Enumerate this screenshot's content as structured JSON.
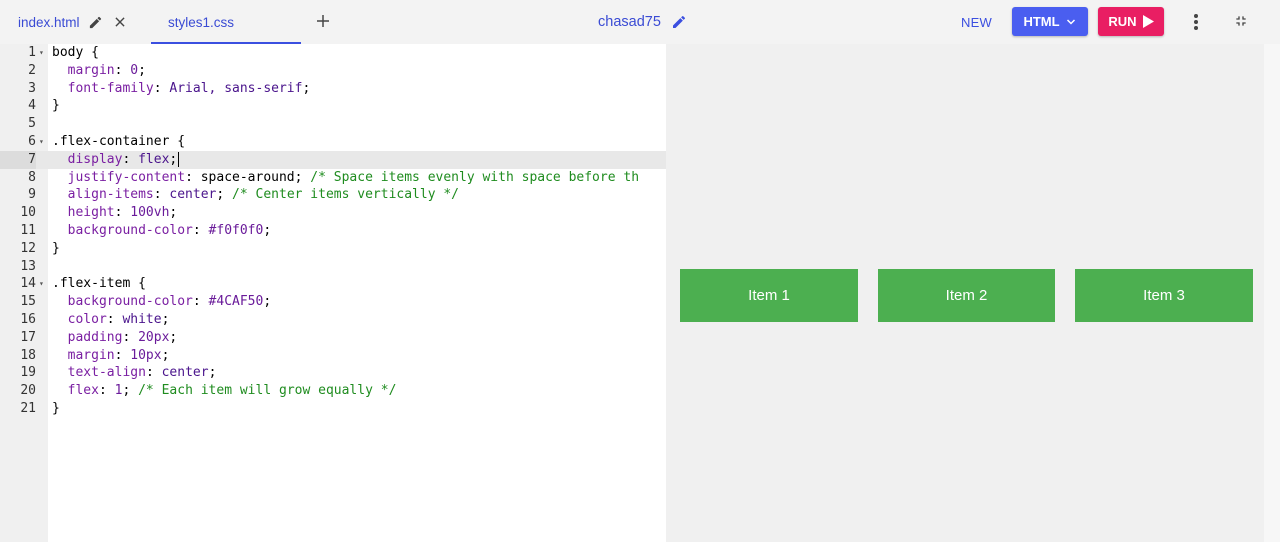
{
  "tabs": [
    {
      "label": "index.html"
    },
    {
      "label": "styles1.css"
    }
  ],
  "project": {
    "name": "chasad75"
  },
  "toolbar": {
    "new_label": "NEW",
    "html_label": "HTML",
    "run_label": "RUN"
  },
  "colors": {
    "accent": "#4a5ef0",
    "run": "#e91e63",
    "item": "#4caf50"
  },
  "editor": {
    "active_line": 7,
    "lines": [
      {
        "n": "1",
        "fold": true
      },
      {
        "n": "2"
      },
      {
        "n": "3"
      },
      {
        "n": "4"
      },
      {
        "n": "5"
      },
      {
        "n": "6",
        "fold": true
      },
      {
        "n": "7"
      },
      {
        "n": "8"
      },
      {
        "n": "9"
      },
      {
        "n": "10"
      },
      {
        "n": "11"
      },
      {
        "n": "12"
      },
      {
        "n": "13"
      },
      {
        "n": "14",
        "fold": true
      },
      {
        "n": "15"
      },
      {
        "n": "16"
      },
      {
        "n": "17"
      },
      {
        "n": "18"
      },
      {
        "n": "19"
      },
      {
        "n": "20"
      },
      {
        "n": "21"
      }
    ],
    "code": {
      "l1": "body {",
      "l2_prop": "margin",
      "l2_val": "0",
      "l3_prop": "font-family",
      "l3_val": "Arial, sans-serif",
      "l4": "}",
      "l6": ".flex-container {",
      "l7_prop": "display",
      "l7_val": "flex",
      "l8_prop": "justify-content",
      "l8_val": "space-around",
      "l8_cm": "/* Space items evenly with space before th",
      "l9_prop": "align-items",
      "l9_val": "center",
      "l9_cm": "/* Center items vertically */",
      "l10_prop": "height",
      "l10_val": "100vh",
      "l11_prop": "background-color",
      "l11_val": "#f0f0f0",
      "l12": "}",
      "l14": ".flex-item {",
      "l15_prop": "background-color",
      "l15_val": "#4CAF50",
      "l16_prop": "color",
      "l16_val": "white",
      "l17_prop": "padding",
      "l17_val": "20px",
      "l18_prop": "margin",
      "l18_val": "10px",
      "l19_prop": "text-align",
      "l19_val": "center",
      "l20_prop": "flex",
      "l20_val": "1",
      "l20_cm": "/* Each item will grow equally */",
      "l21": "}"
    }
  },
  "preview": {
    "items": [
      "Item 1",
      "Item 2",
      "Item 3"
    ]
  }
}
